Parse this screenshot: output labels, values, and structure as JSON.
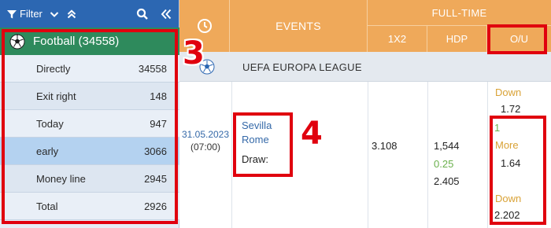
{
  "sidebar": {
    "filter_label": "Filter",
    "sport": {
      "name": "Football",
      "count": "(34558)"
    },
    "items": [
      {
        "label": "Directly",
        "count": "34558"
      },
      {
        "label": "Exit right",
        "count": "148"
      },
      {
        "label": "Today",
        "count": "947"
      },
      {
        "label": "early",
        "count": "3066"
      },
      {
        "label": "Money line",
        "count": "2945"
      },
      {
        "label": "Total",
        "count": "2926"
      }
    ],
    "active_item": "early"
  },
  "header": {
    "events_label": "EVENTS",
    "fulltime_label": "FULL-TIME",
    "cols": [
      "1X2",
      "HDP",
      "O/U"
    ]
  },
  "league": {
    "name": "UEFA EUROPA LEAGUE"
  },
  "match": {
    "date": "31.05.2023",
    "time": "(07:00)",
    "home": "Sevilla",
    "away": "Rome",
    "draw": "Draw:",
    "x12_home": "3.108",
    "hdp_home": "1,544",
    "hdp_line": "0.25",
    "hdp_away": "2.405",
    "ou_top_label": "Down",
    "ou_top_value": "1.72",
    "ou_line": "1",
    "ou_more_label": "More",
    "ou_more_value": "1.64",
    "ou_down_label": "Down",
    "ou_down_value": "2.202"
  },
  "annotations": {
    "label_3": "3",
    "label_4": "4"
  },
  "colors": {
    "toolbar_blue": "#2c67b2",
    "sport_green": "#2e8a5c",
    "header_orange": "#efa95a",
    "annotation_red": "#e0000e",
    "odds_green": "#6ab04c",
    "odds_gold": "#d9a236"
  },
  "icons": {
    "filter": "filter-icon",
    "expand": "chevron-down-icon",
    "collapse_all": "double-chevron-up-icon",
    "search": "search-icon",
    "collapse_sidebar": "double-chevron-left-icon",
    "sport": "soccer-ball-icon",
    "clock": "clock-icon"
  }
}
